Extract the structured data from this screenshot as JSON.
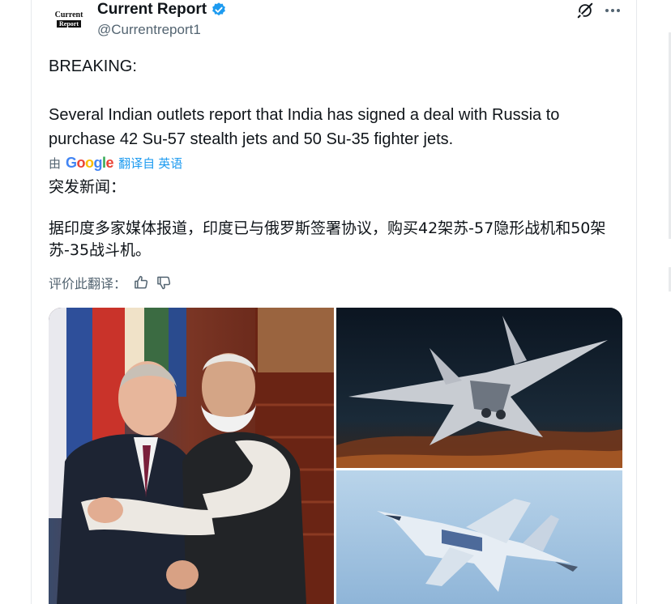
{
  "post": {
    "avatar": {
      "line1": "Current",
      "line2": "Report"
    },
    "display_name": "Current Report",
    "handle": "@Currentreport1",
    "text_breaking": "BREAKING:",
    "text_body": "Several Indian outlets report that India has signed a deal with Russia to purchase 42 Su-57 stealth jets and 50 Su-35 fighter jets.",
    "translate": {
      "by": "由",
      "google_G": "G",
      "google_o1": "o",
      "google_o2": "o",
      "google_g": "g",
      "google_l": "l",
      "google_e": "e",
      "link": "翻译自 英语"
    },
    "zh_breaking": "突发新闻：",
    "zh_body": "据印度多家媒体报道，印度已与俄罗斯签署协议，购买42架苏-57隐形战机和50架苏-35战斗机。",
    "rate_label": "评价此翻译："
  },
  "colors": {
    "accent": "#1d9bf0",
    "secondary_text": "#536471",
    "google_blue": "#4285f4",
    "google_red": "#ea4335",
    "google_yellow": "#fbbc05",
    "google_green": "#34a853"
  },
  "icons": {
    "verified": "verified-badge-icon",
    "grok": "grok-icon",
    "more": "more-icon",
    "thumbs_up": "thumbs-up-icon",
    "thumbs_down": "thumbs-down-icon"
  }
}
